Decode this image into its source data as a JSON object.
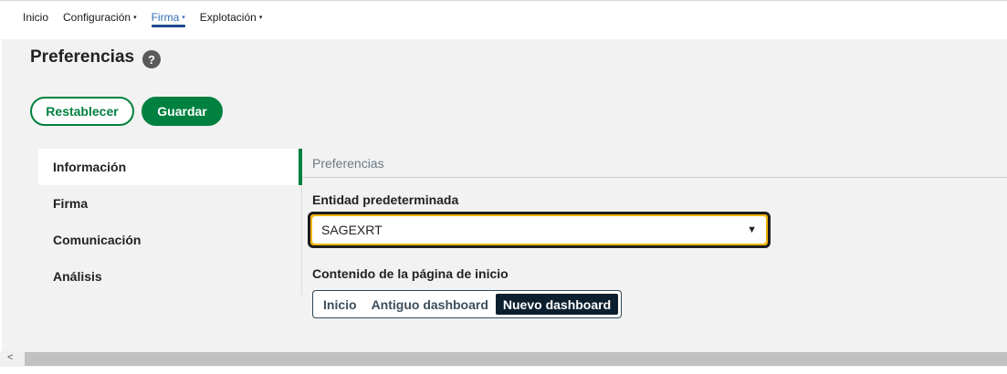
{
  "nav": {
    "items": [
      {
        "label": "Inicio",
        "has_caret": false,
        "active": false
      },
      {
        "label": "Configuración",
        "has_caret": true,
        "active": false
      },
      {
        "label": "Firma",
        "has_caret": true,
        "active": true
      },
      {
        "label": "Explotación",
        "has_caret": true,
        "active": false
      }
    ],
    "caret": "▾"
  },
  "page": {
    "title": "Preferencias",
    "help_glyph": "?"
  },
  "actions": {
    "reset_label": "Restablecer",
    "save_label": "Guardar"
  },
  "sidebar": {
    "items": [
      {
        "label": "Información",
        "active": true
      },
      {
        "label": "Firma",
        "active": false
      },
      {
        "label": "Comunicación",
        "active": false
      },
      {
        "label": "Análisis",
        "active": false
      }
    ]
  },
  "content": {
    "section_heading": "Preferencias",
    "entity_label": "Entidad predeterminada",
    "entity_value": "SAGEXRT",
    "select_caret": "▼",
    "home_label": "Contenido de la página de inicio",
    "home_options": [
      {
        "label": "Inicio",
        "active": false
      },
      {
        "label": "Antiguo dashboard",
        "active": false
      },
      {
        "label": "Nuevo dashboard",
        "active": true
      }
    ]
  },
  "scrollbar": {
    "left_arrow": "<"
  },
  "colors": {
    "brand_green": "#00813f",
    "focus_yellow": "#f0b400",
    "nav_active": "#1a4a8c",
    "segment_active": "#0b1f2f"
  }
}
